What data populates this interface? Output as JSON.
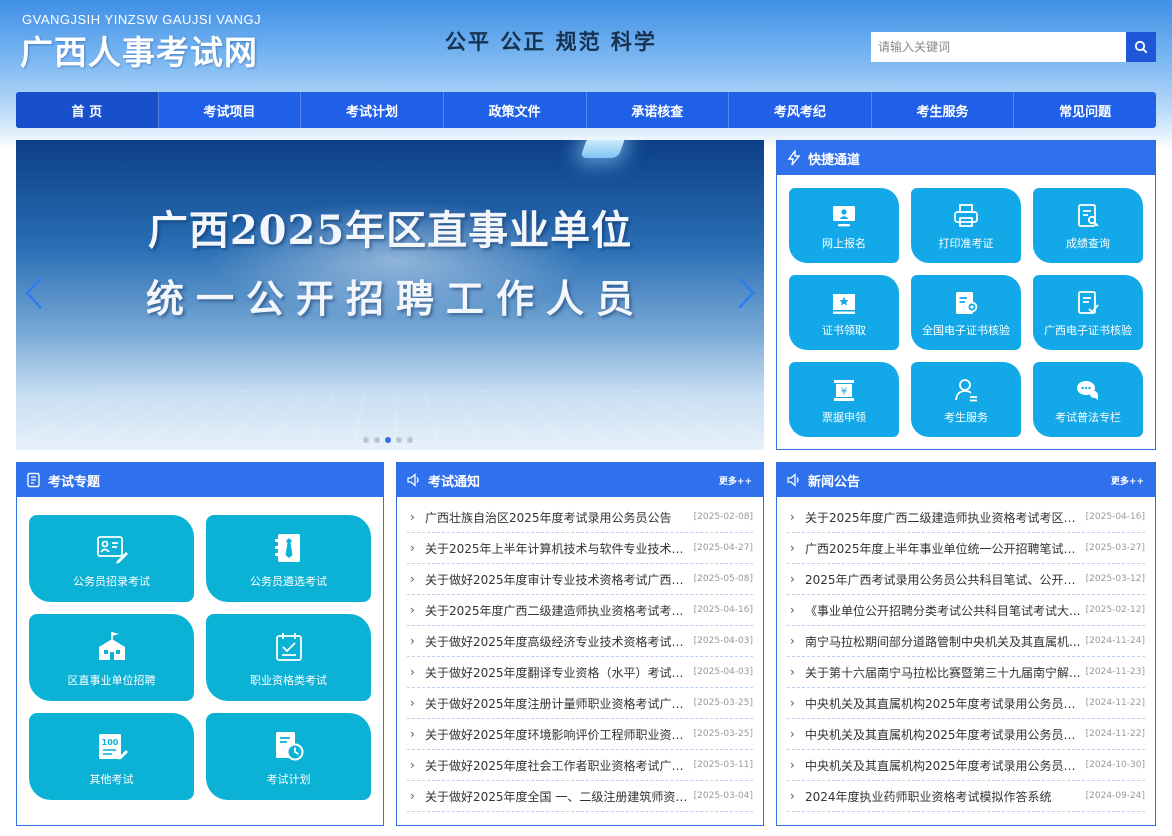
{
  "header": {
    "pinyin": "GVANGJSIH YINZSW GAUJSI VANGJ",
    "site_name": "广西人事考试网",
    "slogan": "公平  公正  规范  科学",
    "search_placeholder": "请输入关键词",
    "search_icon": "search-icon"
  },
  "nav": {
    "items": [
      {
        "label": "首 页",
        "active": true
      },
      {
        "label": "考试项目"
      },
      {
        "label": "考试计划"
      },
      {
        "label": "政策文件"
      },
      {
        "label": "承诺核查"
      },
      {
        "label": "考风考纪"
      },
      {
        "label": "考生服务"
      },
      {
        "label": "常见问题"
      }
    ]
  },
  "banner": {
    "line1": "广西2025年区直事业单位",
    "line2": "统一公开招聘工作人员",
    "slide_count": 5,
    "active_slide": 3
  },
  "quick": {
    "title": "快捷通道",
    "tiles": [
      {
        "label": "网上报名",
        "icon": "monitor-icon"
      },
      {
        "label": "打印准考证",
        "icon": "printer-icon"
      },
      {
        "label": "成绩查询",
        "icon": "document-search-icon"
      },
      {
        "label": "证书领取",
        "icon": "certificate-icon"
      },
      {
        "label": "全国电子证书核验",
        "icon": "e-certificate-icon"
      },
      {
        "label": "广西电子证书核验",
        "icon": "document-check-icon"
      },
      {
        "label": "票据申领",
        "icon": "receipt-icon"
      },
      {
        "label": "考生服务",
        "icon": "user-service-icon"
      },
      {
        "label": "考试普法专栏",
        "icon": "chat-bubble-icon"
      }
    ]
  },
  "topics": {
    "title": "考试专题",
    "tiles": [
      {
        "label": "公务员招录考试",
        "icon": "id-card-pen-icon"
      },
      {
        "label": "公务员遴选考试",
        "icon": "tie-book-icon"
      },
      {
        "label": "区直事业单位招聘",
        "icon": "building-icon"
      },
      {
        "label": "职业资格类考试",
        "icon": "calendar-board-icon"
      },
      {
        "label": "其他考试",
        "icon": "score-paper-icon"
      },
      {
        "label": "考试计划",
        "icon": "doc-clock-icon"
      }
    ]
  },
  "notice": {
    "title": "考试通知",
    "more": "更多++",
    "items": [
      {
        "title": "广西壮族自治区2025年度考试录用公务员公告",
        "date": "[2025-02-08]"
      },
      {
        "title": "关于2025年上半年计算机技术与软件专业技术资...",
        "date": "[2025-04-27]"
      },
      {
        "title": "关于做好2025年度审计专业技术资格考试广西考...",
        "date": "[2025-05-08]"
      },
      {
        "title": "关于2025年度广西二级建造师执业资格考试考区...",
        "date": "[2025-04-16]"
      },
      {
        "title": "关于做好2025年度高级经济专业技术资格考试广...",
        "date": "[2025-04-03]"
      },
      {
        "title": "关于做好2025年度翻译专业资格（水平）考试广...",
        "date": "[2025-04-03]"
      },
      {
        "title": "关于做好2025年度注册计量师职业资格考试广西...",
        "date": "[2025-03-25]"
      },
      {
        "title": "关于做好2025年度环境影响评价工程师职业资格...",
        "date": "[2025-03-25]"
      },
      {
        "title": "关于做好2025年度社会工作者职业资格考试广西...",
        "date": "[2025-03-11]"
      },
      {
        "title": "关于做好2025年度全国 一、二级注册建筑师资格...",
        "date": "[2025-03-04]"
      }
    ]
  },
  "news": {
    "title": "新闻公告",
    "more": "更多++",
    "items": [
      {
        "title": "关于2025年度广西二级建造师执业资格考试考区设...",
        "date": "[2025-04-16]"
      },
      {
        "title": "广西2025年度上半年事业单位统一公开招聘笔试考...",
        "date": "[2025-03-27]"
      },
      {
        "title": "2025年广西考试录用公务员公共科目笔试、公开遴...",
        "date": "[2025-03-12]"
      },
      {
        "title": "《事业单位公开招聘分类考试公共科目笔试考试大...",
        "date": "[2025-02-12]"
      },
      {
        "title": "南宁马拉松期间部分道路管制中央机关及其直属机...",
        "date": "[2024-11-24]"
      },
      {
        "title": "关于第十六届南宁马拉松比赛暨第三十九届南宁解...",
        "date": "[2024-11-23]"
      },
      {
        "title": "中央机关及其直属机构2025年度考试录用公务员笔...",
        "date": "[2024-11-22]"
      },
      {
        "title": "中央机关及其直属机构2025年度考试录用公务员笔...",
        "date": "[2024-11-22]"
      },
      {
        "title": "中央机关及其直属机构2025年度考试录用公务员笔...",
        "date": "[2024-10-30]"
      },
      {
        "title": "2024年度执业药师职业资格考试模拟作答系统",
        "date": "[2024-09-24]"
      }
    ]
  },
  "colors": {
    "nav_bg": "#2060e8",
    "panel_head": "#2f70ec",
    "quick_tile": "#13a9e8",
    "topic_tile": "#0cb2d6",
    "search_btn": "#1e58d8"
  }
}
